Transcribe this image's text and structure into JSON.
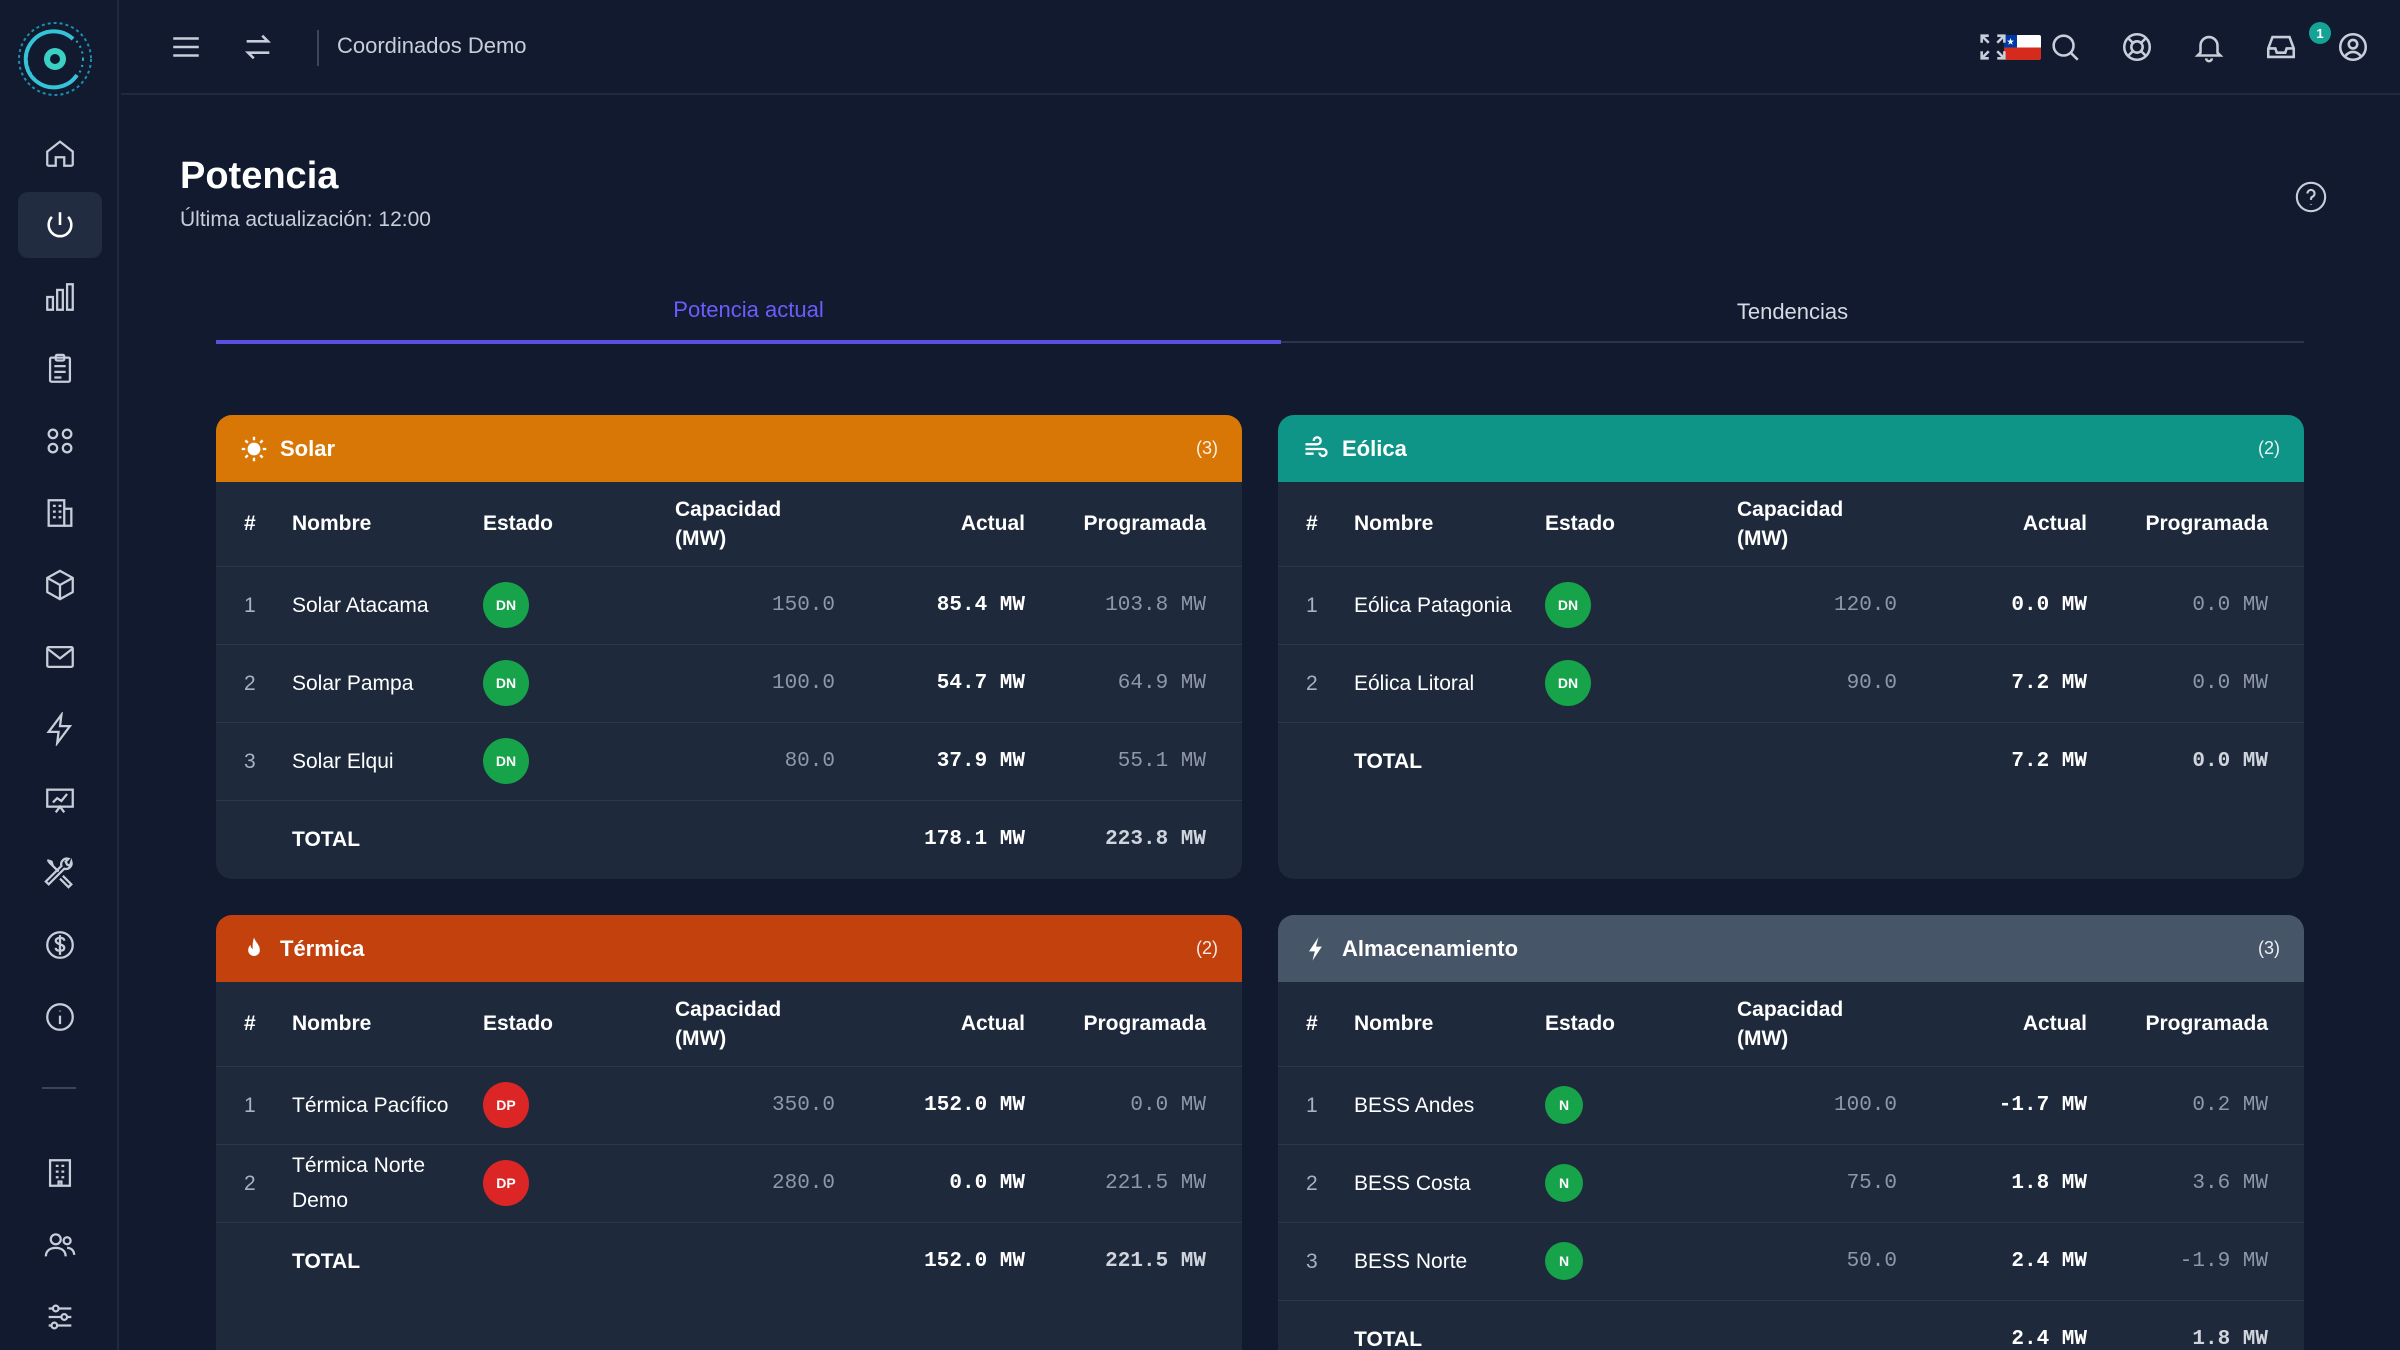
{
  "topbar": {
    "title": "Coordinados Demo"
  },
  "header": {
    "title": "Potencia",
    "subtitle": "Última actualización: 12:00"
  },
  "tabs": [
    {
      "label": "Potencia actual",
      "active": true
    },
    {
      "label": "Tendencias",
      "active": false
    }
  ],
  "notifications": {
    "count": "1"
  },
  "colors": {
    "solar": "#d97706",
    "eolica": "#0f9488",
    "termica": "#c2410c",
    "almacenamiento": "#475569",
    "accent": "#5b4fe0",
    "status_green": "#16a34a",
    "status_red": "#dc2626"
  },
  "columns": {
    "num": "#",
    "name": "Nombre",
    "state": "Estado",
    "capacity": "Capacidad (MW)",
    "actual": "Actual",
    "scheduled": "Programada"
  },
  "cards": {
    "solar": {
      "title": "Solar",
      "count": "(3)",
      "icon": "sun-icon",
      "rows": [
        {
          "num": "1",
          "name": "Solar Atacama",
          "state": "DN",
          "capacity": "150.0",
          "actual": "85.4 MW",
          "scheduled": "103.8 MW"
        },
        {
          "num": "2",
          "name": "Solar Pampa",
          "state": "DN",
          "capacity": "100.0",
          "actual": "54.7 MW",
          "scheduled": "64.9 MW"
        },
        {
          "num": "3",
          "name": "Solar Elqui",
          "state": "DN",
          "capacity": "80.0",
          "actual": "37.9 MW",
          "scheduled": "55.1 MW"
        }
      ],
      "total": {
        "label": "TOTAL",
        "actual": "178.1 MW",
        "scheduled": "223.8 MW"
      }
    },
    "eolica": {
      "title": "Eólica",
      "count": "(2)",
      "icon": "wind-icon",
      "rows": [
        {
          "num": "1",
          "name": "Eólica Patagonia",
          "state": "DN",
          "capacity": "120.0",
          "actual": "0.0 MW",
          "scheduled": "0.0 MW"
        },
        {
          "num": "2",
          "name": "Eólica Litoral",
          "state": "DN",
          "capacity": "90.0",
          "actual": "7.2 MW",
          "scheduled": "0.0 MW"
        }
      ],
      "total": {
        "label": "TOTAL",
        "actual": "7.2 MW",
        "scheduled": "0.0 MW"
      }
    },
    "termica": {
      "title": "Térmica",
      "count": "(2)",
      "icon": "flame-icon",
      "rows": [
        {
          "num": "1",
          "name": "Térmica Pacífico",
          "state": "DP",
          "capacity": "350.0",
          "actual": "152.0 MW",
          "scheduled": "0.0 MW"
        },
        {
          "num": "2",
          "name": "Térmica Norte Demo",
          "state": "DP",
          "capacity": "280.0",
          "actual": "0.0 MW",
          "scheduled": "221.5 MW"
        }
      ],
      "total": {
        "label": "TOTAL",
        "actual": "152.0 MW",
        "scheduled": "221.5 MW"
      }
    },
    "almacenamiento": {
      "title": "Almacenamiento",
      "count": "(3)",
      "icon": "bolt-icon",
      "rows": [
        {
          "num": "1",
          "name": "BESS Andes",
          "state": "N",
          "capacity": "100.0",
          "actual": "-1.7 MW",
          "scheduled": "0.2 MW"
        },
        {
          "num": "2",
          "name": "BESS Costa",
          "state": "N",
          "capacity": "75.0",
          "actual": "1.8 MW",
          "scheduled": "3.6 MW"
        },
        {
          "num": "3",
          "name": "BESS Norte",
          "state": "N",
          "capacity": "50.0",
          "actual": "2.4 MW",
          "scheduled": "-1.9 MW"
        }
      ],
      "total": {
        "label": "TOTAL",
        "actual": "2.4 MW",
        "scheduled": "1.8 MW"
      }
    }
  }
}
